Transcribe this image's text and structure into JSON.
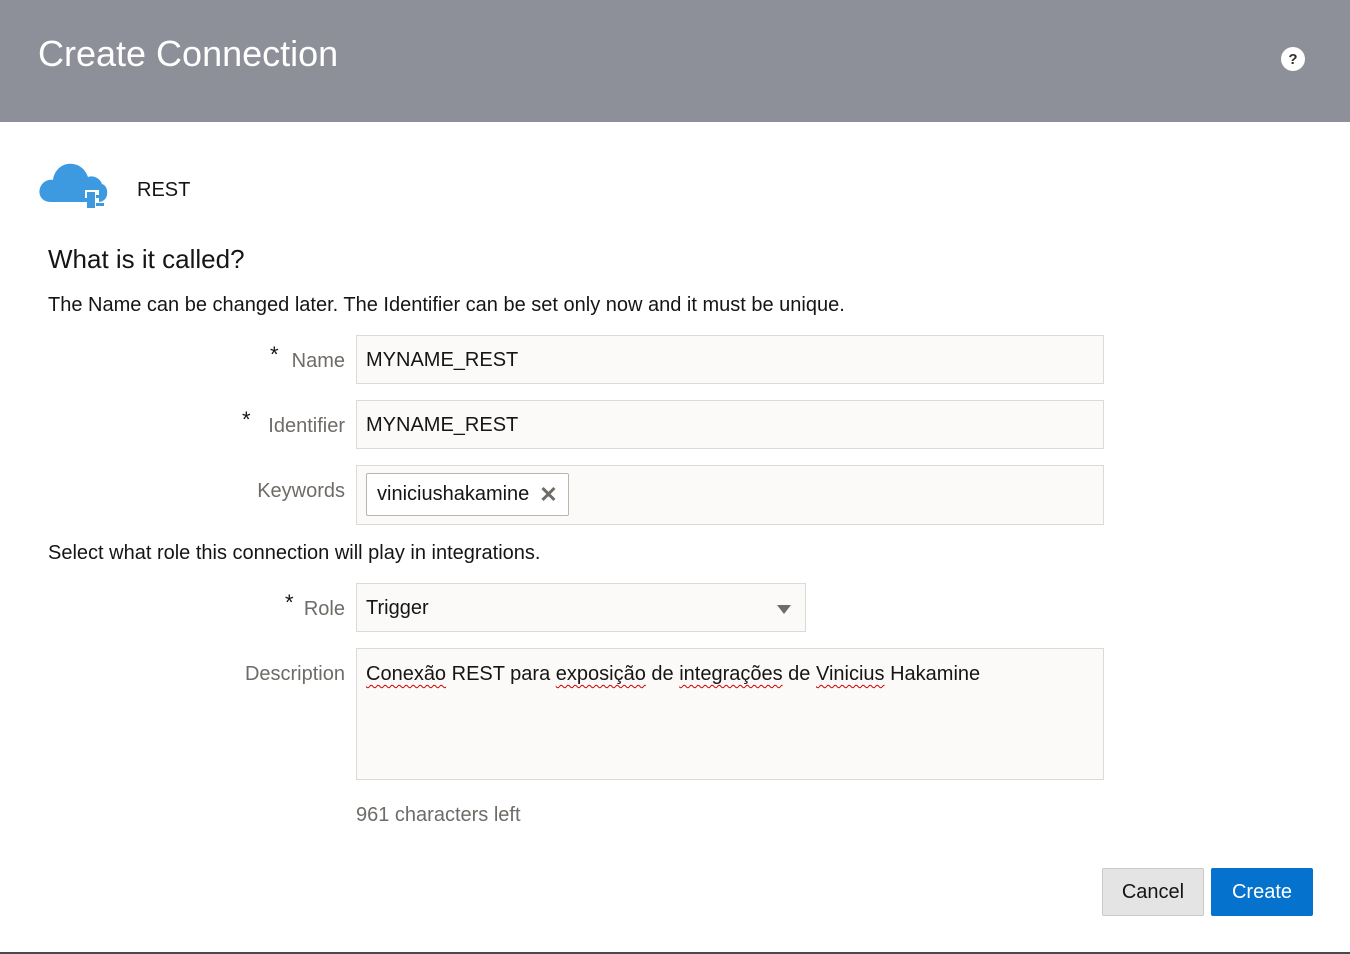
{
  "dialog": {
    "title": "Create Connection",
    "help_glyph": "?",
    "help_icon": "help-icon"
  },
  "adapter": {
    "icon": "cloud-plug-icon",
    "icon_color": "#3d9ae1",
    "name": "REST"
  },
  "section": {
    "title": "What is it called?",
    "hint": "The Name can be changed later. The Identifier can be set only now and it must be unique."
  },
  "fields": {
    "required_marker": "*",
    "name": {
      "label": "Name",
      "value": "MYNAME_REST"
    },
    "identifier": {
      "label": "Identifier",
      "value": "MYNAME_REST"
    },
    "keywords": {
      "label": "Keywords",
      "chips": [
        "viniciushakamine"
      ],
      "remove_glyph": "✕"
    },
    "role_hint": "Select what role this connection will play in integrations.",
    "role": {
      "label": "Role",
      "value": "Trigger"
    },
    "description": {
      "label": "Description",
      "words": [
        "Conexão",
        "REST",
        "para",
        "exposição",
        "de",
        "integrações",
        "de",
        "Vinicius",
        "Hakamine"
      ],
      "misspelled": [
        true,
        false,
        false,
        true,
        false,
        true,
        false,
        true,
        false
      ]
    },
    "counter": "961 characters left"
  },
  "buttons": {
    "cancel": "Cancel",
    "create": "Create",
    "create_color": "#0572ce"
  }
}
